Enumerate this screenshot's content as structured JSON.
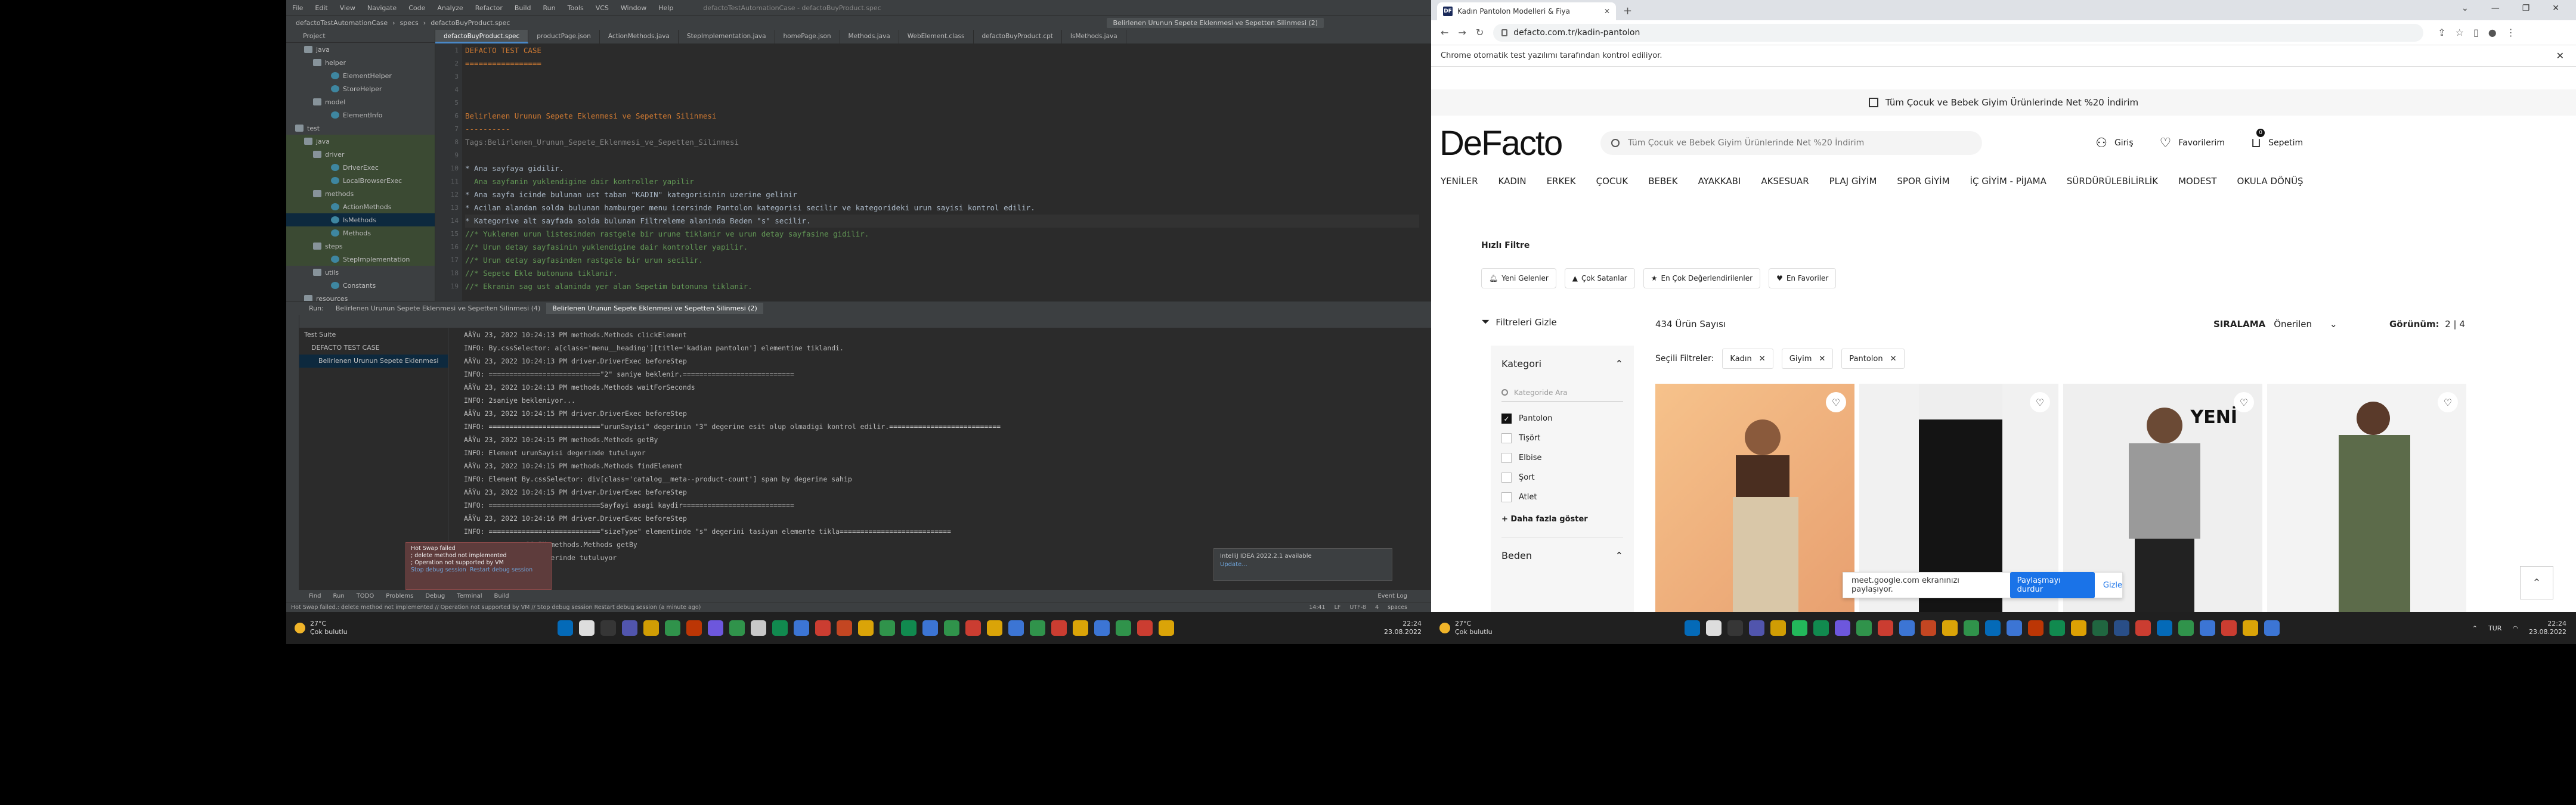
{
  "ide": {
    "menu": [
      "File",
      "Edit",
      "View",
      "Navigate",
      "Code",
      "Analyze",
      "Refactor",
      "Build",
      "Run",
      "Tools",
      "VCS",
      "Window",
      "Help"
    ],
    "title": "defactoTestAutomationCase - defactoBuyProduct.spec",
    "nav": {
      "project": "defactoTestAutomationCase",
      "sep1": "specs",
      "file": "defactoBuyProduct.spec"
    },
    "run_config": "Belirlenen Urunun Sepete Eklenmesi ve Sepetten Silinmesi (2)",
    "project_header": "Project",
    "tree": [
      {
        "label": "java",
        "indent": 30,
        "icon": "folder",
        "sel": false,
        "hl": false
      },
      {
        "label": "helper",
        "indent": 45,
        "icon": "folder",
        "sel": false,
        "hl": false
      },
      {
        "label": "ElementHelper",
        "indent": 75,
        "icon": "cls",
        "sel": false,
        "hl": false
      },
      {
        "label": "StoreHelper",
        "indent": 75,
        "icon": "cls",
        "sel": false,
        "hl": false
      },
      {
        "label": "model",
        "indent": 45,
        "icon": "folder",
        "sel": false,
        "hl": false
      },
      {
        "label": "ElementInfo",
        "indent": 75,
        "icon": "cls",
        "sel": false,
        "hl": false
      },
      {
        "label": "test",
        "indent": 15,
        "icon": "folder",
        "sel": false,
        "hl": false
      },
      {
        "label": "java",
        "indent": 30,
        "icon": "folder",
        "sel": false,
        "hl": true
      },
      {
        "label": "driver",
        "indent": 45,
        "icon": "folder",
        "sel": false,
        "hl": true
      },
      {
        "label": "DriverExec",
        "indent": 75,
        "icon": "cls",
        "sel": false,
        "hl": true
      },
      {
        "label": "LocalBrowserExec",
        "indent": 75,
        "icon": "cls",
        "sel": false,
        "hl": true
      },
      {
        "label": "methods",
        "indent": 45,
        "icon": "folder",
        "sel": false,
        "hl": true
      },
      {
        "label": "ActionMethods",
        "indent": 75,
        "icon": "cls",
        "sel": false,
        "hl": true
      },
      {
        "label": "IsMethods",
        "indent": 75,
        "icon": "cls",
        "sel": true,
        "hl": false
      },
      {
        "label": "Methods",
        "indent": 75,
        "icon": "cls",
        "sel": false,
        "hl": true
      },
      {
        "label": "steps",
        "indent": 45,
        "icon": "folder",
        "sel": false,
        "hl": true
      },
      {
        "label": "StepImplementation",
        "indent": 75,
        "icon": "cls",
        "sel": false,
        "hl": true
      },
      {
        "label": "utils",
        "indent": 45,
        "icon": "folder",
        "sel": false,
        "hl": false
      },
      {
        "label": "Constants",
        "indent": 75,
        "icon": "cls",
        "sel": false,
        "hl": false
      },
      {
        "label": "resources",
        "indent": 30,
        "icon": "folder",
        "sel": false,
        "hl": false
      }
    ],
    "editor_tabs": [
      {
        "label": "defactoBuyProduct.spec",
        "active": true
      },
      {
        "label": "productPage.json",
        "active": false
      },
      {
        "label": "ActionMethods.java",
        "active": false
      },
      {
        "label": "StepImplementation.java",
        "active": false
      },
      {
        "label": "homePage.json",
        "active": false
      },
      {
        "label": "Methods.java",
        "active": false
      },
      {
        "label": "WebElement.class",
        "active": false
      },
      {
        "label": "defactoBuyProduct.cpt",
        "active": false
      },
      {
        "label": "IsMethods.java",
        "active": false
      }
    ],
    "code_lines": [
      {
        "n": "1",
        "t": "DEFACTO TEST CASE",
        "c": "c-h1"
      },
      {
        "n": "2",
        "t": "=================",
        "c": "c-h1"
      },
      {
        "n": "3",
        "t": "",
        "c": ""
      },
      {
        "n": "4",
        "t": "",
        "c": ""
      },
      {
        "n": "5",
        "t": "",
        "c": ""
      },
      {
        "n": "6",
        "t": "Belirlenen Urunun Sepete Eklenmesi ve Sepetten Silinmesi",
        "c": "c-h2"
      },
      {
        "n": "7",
        "t": "----------",
        "c": "c-h2"
      },
      {
        "n": "8",
        "t": "Tags:Belirlenen_Urunun_Sepete_Eklenmesi_ve_Sepetten_Silinmesi",
        "c": "c-tag"
      },
      {
        "n": "9",
        "t": "",
        "c": ""
      },
      {
        "n": "10",
        "t": "* Ana sayfaya gidilir.",
        "c": "c-step"
      },
      {
        "n": "11",
        "t": "  Ana sayfanin yuklendigine dair kontroller yapilir",
        "c": "c-cmt"
      },
      {
        "n": "12",
        "t": "* Ana sayfa icinde bulunan ust taban \"KADIN\" kategorisinin uzerine gelinir",
        "c": "c-step"
      },
      {
        "n": "13",
        "t": "* Acilan alandan solda bulunan hamburger menu icersinde Pantolon kategorisi secilir ve kategorideki urun sayisi kontrol edilir.",
        "c": "c-step"
      },
      {
        "n": "14",
        "t": "* Kategorive alt sayfada solda bulunan Filtreleme alaninda Beden \"s\" secilir.",
        "c": "c-step c-cur"
      },
      {
        "n": "15",
        "t": "//* Yuklenen urun listesinden rastgele bir urune tiklanir ve urun detay sayfasine gidilir.",
        "c": "c-cmt"
      },
      {
        "n": "16",
        "t": "//* Urun detay sayfasinin yuklendigine dair kontroller yapilir.",
        "c": "c-cmt"
      },
      {
        "n": "17",
        "t": "//* Urun detay sayfasinden rastgele bir urun secilir.",
        "c": "c-cmt"
      },
      {
        "n": "18",
        "t": "//* Sepete Ekle butonuna tiklanir.",
        "c": "c-cmt"
      },
      {
        "n": "19",
        "t": "//* Ekranin sag ust alaninda yer alan Sepetim butonuna tiklanir.",
        "c": "c-cmt"
      }
    ],
    "run_tabs": [
      {
        "label": "Run:",
        "active": false
      },
      {
        "label": "Belirlenen Urunun Sepete Eklenmesi ve Sepetten Silinmesi (4)",
        "active": false
      },
      {
        "label": "Belirlenen Urunun Sepete Eklenmesi ve Sepetten Silinmesi (2)",
        "active": true
      }
    ],
    "test_tree": [
      {
        "label": "Test Suite",
        "indent": 8,
        "sel": false
      },
      {
        "label": "DEFACTO TEST CASE",
        "indent": 20,
        "sel": false
      },
      {
        "label": "Belirlenen Urunun Sepete Eklenmesi",
        "indent": 32,
        "sel": true
      }
    ],
    "console": [
      "AÄŸu 23, 2022 10:24:13 PM methods.Methods clickElement",
      "INFO: By.cssSelector: a[class='menu__heading'][title='kadian pantolon'] elementine tiklandi.",
      "AÄŸu 23, 2022 10:24:13 PM driver.DriverExec beforeStep",
      "INFO: ===========================\"2\" saniye beklenir.===========================",
      "AÄŸu 23, 2022 10:24:13 PM methods.Methods waitForSeconds",
      "INFO: 2saniye bekleniyor...",
      "AÄŸu 23, 2022 10:24:15 PM driver.DriverExec beforeStep",
      "INFO: ===========================\"urunSayisi\" degerinin \"3\" degerine esit olup olmadigi kontrol edilir.===========================",
      "AÄŸu 23, 2022 10:24:15 PM methods.Methods getBy",
      "INFO: Element urunSayisi degerinde tutuluyor",
      "AÄŸu 23, 2022 10:24:15 PM methods.Methods findElement",
      "INFO: Element By.cssSelector: div[class='catalog__meta--product-count'] span by degerine sahip",
      "AÄŸu 23, 2022 10:24:15 PM driver.DriverExec beforeStep",
      "INFO: ===========================Sayfayi asagi kaydir===========================",
      "AÄŸu 23, 2022 10:24:16 PM driver.DriverExec beforeStep",
      "INFO: ===========================\"sizeType\" elementinde \"s\" degerini tasiyan elemente tikla===========================",
      "               16 PM methods.Methods getBy",
      "               se degerinde tutuluyor"
    ],
    "hotswap": {
      "l1": "Hot Swap failed",
      "l2": "; delete method not implemented",
      "l3": "; Operation not supported by VM",
      "l4": "Stop debug session",
      "l5": "Restart debug session"
    },
    "intellij_note": {
      "l1": "IntelliJ IDEA 2022.2.1 available",
      "l2": "Update..."
    },
    "bottom_tabs": [
      "Find",
      "Run",
      "TODO",
      "Problems",
      "Debug",
      "Terminal",
      "Build"
    ],
    "event_log": "Event Log",
    "status_left": "Hot Swap failed.: delete method not implemented // Operation not supported by VM // Stop debug session   Restart debug session (a minute ago)",
    "status_right": "14:41  LF  UTF-8  4 spaces"
  },
  "taskbar_left": {
    "temp": "27°C",
    "weather": "Çok bulutlu",
    "time": "22:24",
    "date": "23.08.2022"
  },
  "taskbar_right": {
    "temp": "27°C",
    "weather": "Çok bulutlu",
    "lang": "TUR",
    "time": "22:24",
    "date": "23.08.2022",
    "badge": "9"
  },
  "browser": {
    "tab_title": "Kadın Pantolon Modelleri & Fiya",
    "favicon": "DF",
    "url": "defacto.com.tr/kadin-pantolon",
    "infobar": "Chrome otomatik test yazılımı tarafından kontrol ediliyor.",
    "promo": "Tüm Çocuk ve Bebek Giyim Ürünlerinde Net %20 İndirim",
    "logo": "DeFacto",
    "search_placeholder": "Tüm Çocuk ve Bebek Giyim Ürünlerinde Net %20 İndirim",
    "login": "Giriş",
    "favorites": "Favorilerim",
    "cart": "Sepetim",
    "cart_count": "0",
    "nav": [
      "YENİLER",
      "KADIN",
      "ERKEK",
      "ÇOCUK",
      "BEBEK",
      "AYAKKABI",
      "AKSESUAR",
      "PLAJ GİYİM",
      "SPOR GİYİM",
      "İÇ GİYİM - PİJAMA",
      "SÜRDÜRÜLEBİLİRLİK",
      "MODEST",
      "OKULA DÖNÜŞ"
    ],
    "quick_filter_title": "Hızlı Filtre",
    "quick_filters": [
      "Yeni Gelenler",
      "Çok Satanlar",
      "En Çok Değerlendirilenler",
      "En Favoriler"
    ],
    "hide_filters": "Filtreleri Gizle",
    "product_count": "434 Ürün Sayısı",
    "sort_label": "SIRALAMA",
    "sort_value": "Önerilen",
    "view_label": "Görünüm:",
    "view_values": "2 | 4",
    "category_title": "Kategori",
    "category_search": "Kategoride Ara",
    "category_options": [
      {
        "label": "Pantolon",
        "checked": true
      },
      {
        "label": "Tişört",
        "checked": false
      },
      {
        "label": "Elbise",
        "checked": false
      },
      {
        "label": "Şort",
        "checked": false
      },
      {
        "label": "Atlet",
        "checked": false
      }
    ],
    "more": "+ Daha fazla göster",
    "size_title": "Beden",
    "selected_label": "Seçili Filtreler:",
    "selected_filters": [
      "Kadın",
      "Giyim",
      "Pantolon"
    ],
    "new_badge": "YENİ",
    "share_text": "meet.google.com ekranınızı paylaşıyor.",
    "share_stop": "Paylaşmayı durdur",
    "share_hide": "Gizle"
  }
}
